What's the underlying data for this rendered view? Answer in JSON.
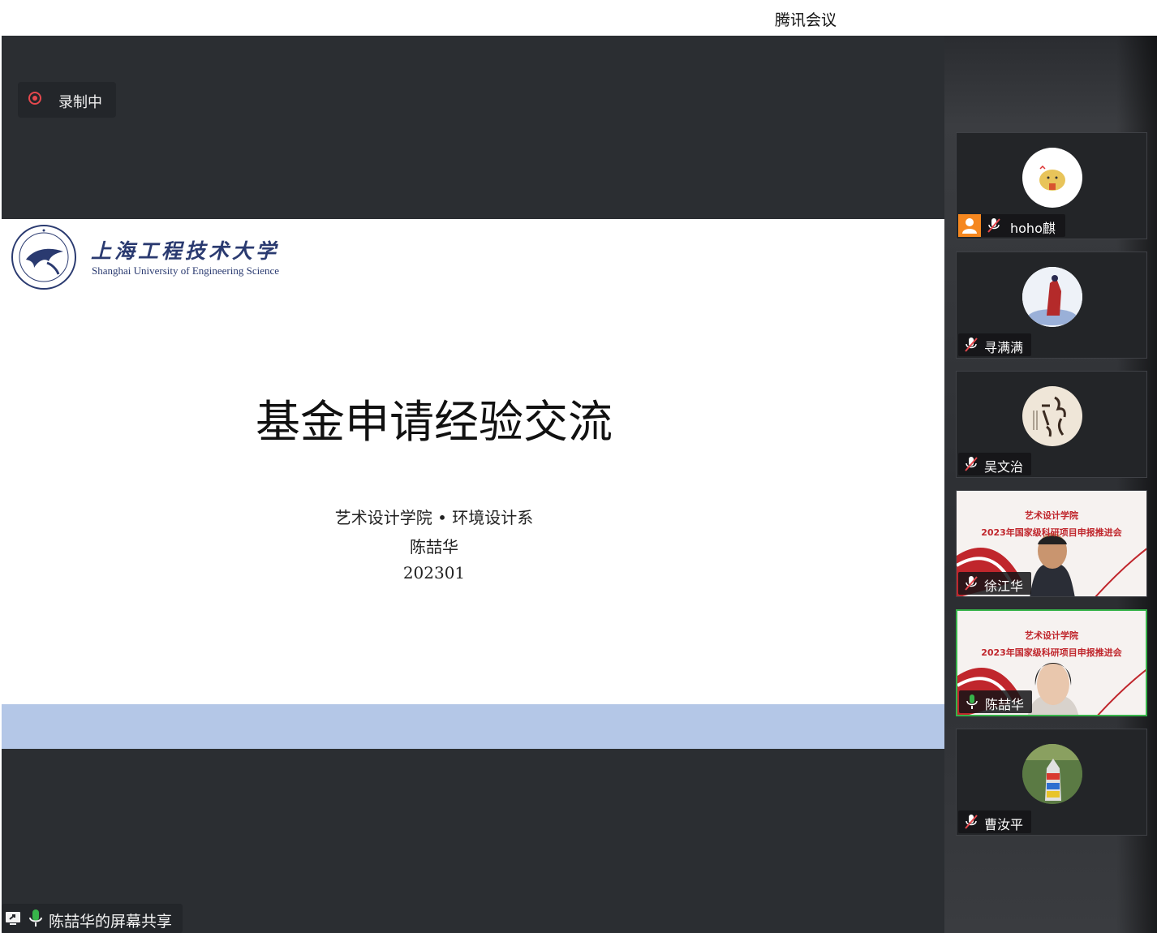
{
  "window": {
    "title": "腾讯会议"
  },
  "recording": {
    "label": "录制中",
    "color": "#e5484d"
  },
  "slide": {
    "university_cn": "上海工程技术大学",
    "university_en": "Shanghai University of Engineering Science",
    "title": "基金申请经验交流",
    "department": "艺术设计学院 • 环境设计系",
    "presenter": "陈喆华",
    "date": "202301",
    "band_color": "#b4c7e7"
  },
  "screen_share": {
    "label": "陈喆华的屏幕共享"
  },
  "participants": [
    {
      "name": "hoho麒",
      "mic": "muted",
      "host_icon": "person-icon",
      "avatar": "cartoon-avatar"
    },
    {
      "name": "寻满满",
      "mic": "muted",
      "avatar": "figure-avatar"
    },
    {
      "name": "吴文治",
      "mic": "muted",
      "avatar": "calligraphy-avatar"
    },
    {
      "name": "徐江华",
      "mic": "muted",
      "video": {
        "line1": "艺术设计学院",
        "line2": "2023年国家级科研项目申报推进会"
      }
    },
    {
      "name": "陈喆华",
      "mic": "active",
      "active_speaker": true,
      "video": {
        "line1": "艺术设计学院",
        "line2": "2023年国家级科研项目申报推进会"
      }
    },
    {
      "name": "曹汝平",
      "mic": "muted",
      "avatar": "statue-avatar"
    }
  ],
  "colors": {
    "active_speaker": "#37b34a",
    "muted": "#e5484d",
    "background": "#2b2e32"
  }
}
